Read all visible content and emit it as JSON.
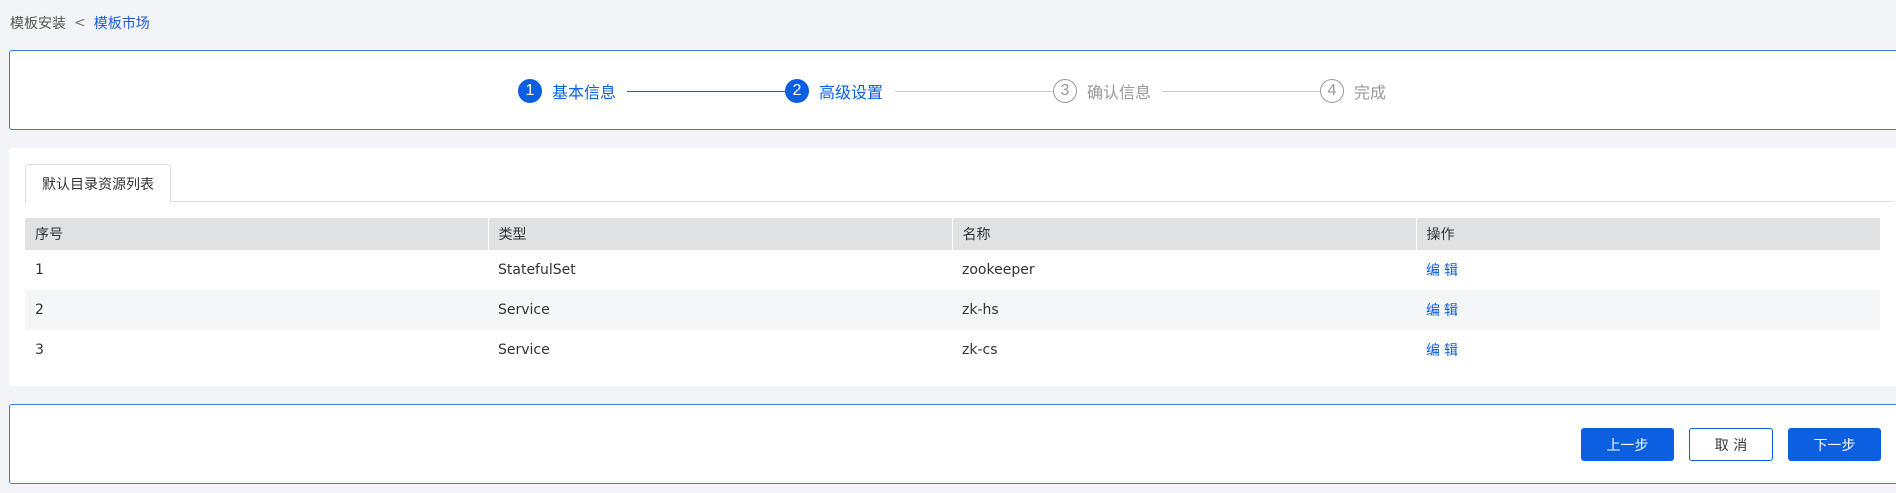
{
  "breadcrumb": {
    "parent": "模板安装",
    "separator": "<",
    "current": "模板市场"
  },
  "steps": [
    {
      "num": "1",
      "label": "基本信息"
    },
    {
      "num": "2",
      "label": "高级设置"
    },
    {
      "num": "3",
      "label": "确认信息"
    },
    {
      "num": "4",
      "label": "完成"
    }
  ],
  "tab": {
    "label": "默认目录资源列表"
  },
  "table": {
    "headers": [
      "序号",
      "类型",
      "名称",
      "操作"
    ],
    "rows": [
      {
        "index": "1",
        "type": "StatefulSet",
        "name": "zookeeper",
        "action": "编辑"
      },
      {
        "index": "2",
        "type": "Service",
        "name": "zk-hs",
        "action": "编辑"
      },
      {
        "index": "3",
        "type": "Service",
        "name": "zk-cs",
        "action": "编辑"
      }
    ]
  },
  "footer": {
    "prev_label": "上一步",
    "cancel_label": "取 消",
    "next_label": "下一步"
  },
  "colors": {
    "accent": "#0b5fe0",
    "header_bg": "#dfe1e3"
  }
}
